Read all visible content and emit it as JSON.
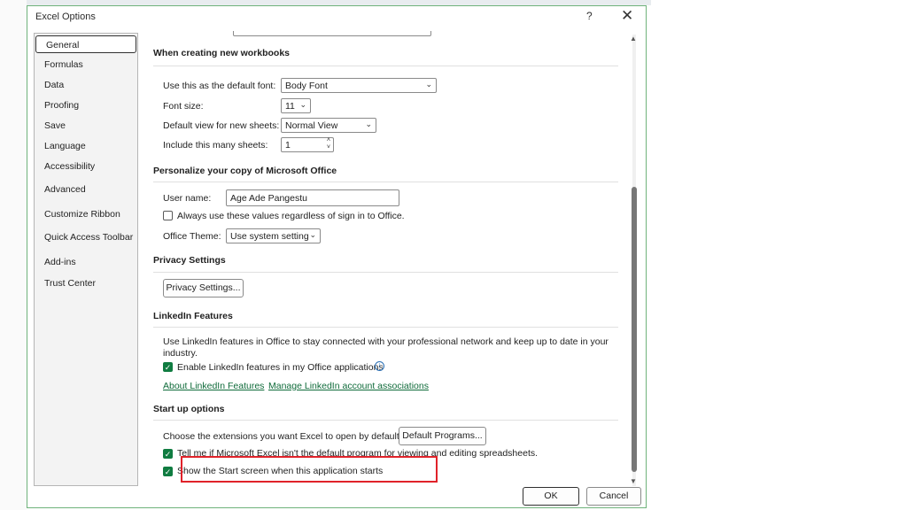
{
  "window": {
    "title": "Excel Options",
    "help": "?",
    "close": "✕"
  },
  "nav": {
    "items": [
      {
        "label": "General"
      },
      {
        "label": "Formulas"
      },
      {
        "label": "Data"
      },
      {
        "label": "Proofing"
      },
      {
        "label": "Save"
      },
      {
        "label": "Language"
      },
      {
        "label": "Accessibility"
      },
      {
        "label": "Advanced"
      },
      {
        "label": "Customize Ribbon"
      },
      {
        "label": "Quick Access Toolbar"
      },
      {
        "label": "Add-ins"
      },
      {
        "label": "Trust Center"
      }
    ],
    "selected": "General"
  },
  "new_workbooks": {
    "heading": "When creating new workbooks",
    "font_label": "Use this as the default font:",
    "font_value": "Body Font",
    "size_label": "Font size:",
    "size_value": "11",
    "view_label": "Default view for new sheets:",
    "view_value": "Normal View",
    "sheets_label": "Include this many sheets:",
    "sheets_value": "1"
  },
  "personalize": {
    "heading": "Personalize your copy of Microsoft Office",
    "user_label": "User name:",
    "user_value": "Age Ade Pangestu",
    "always_label": "Always use these values regardless of sign in to Office.",
    "always_checked": false,
    "theme_label": "Office Theme:",
    "theme_value": "Use system setting"
  },
  "privacy": {
    "heading": "Privacy Settings",
    "button": "Privacy Settings..."
  },
  "linkedin": {
    "heading": "LinkedIn Features",
    "desc_line1": "Use LinkedIn features in Office to stay connected with your professional network and keep up to date in your",
    "desc_line2": "industry.",
    "enable_label": "Enable LinkedIn features in my Office applications",
    "enable_checked": true,
    "info_glyph": "i",
    "link_about": "About LinkedIn Features",
    "link_manage": "Manage LinkedIn account associations"
  },
  "startup": {
    "heading": "Start up options",
    "extensions_label": "Choose the extensions you want Excel to open by default:",
    "default_programs_button": "Default Programs...",
    "tell_me_label": "Tell me if Microsoft Excel isn't the default program for viewing and editing spreadsheets.",
    "tell_me_checked": true,
    "show_start_label": "Show the Start screen when this application starts",
    "show_start_checked": true
  },
  "footer": {
    "ok": "OK",
    "cancel": "Cancel"
  },
  "glyphs": {
    "chevron": "⌄",
    "check": "✓",
    "up": "˄",
    "down": "˅",
    "scroll_up": "▲",
    "scroll_down": "▼"
  },
  "colors": {
    "accent": "#107c41",
    "highlight_box": "#e0222a",
    "link": "#0f6b3a"
  }
}
